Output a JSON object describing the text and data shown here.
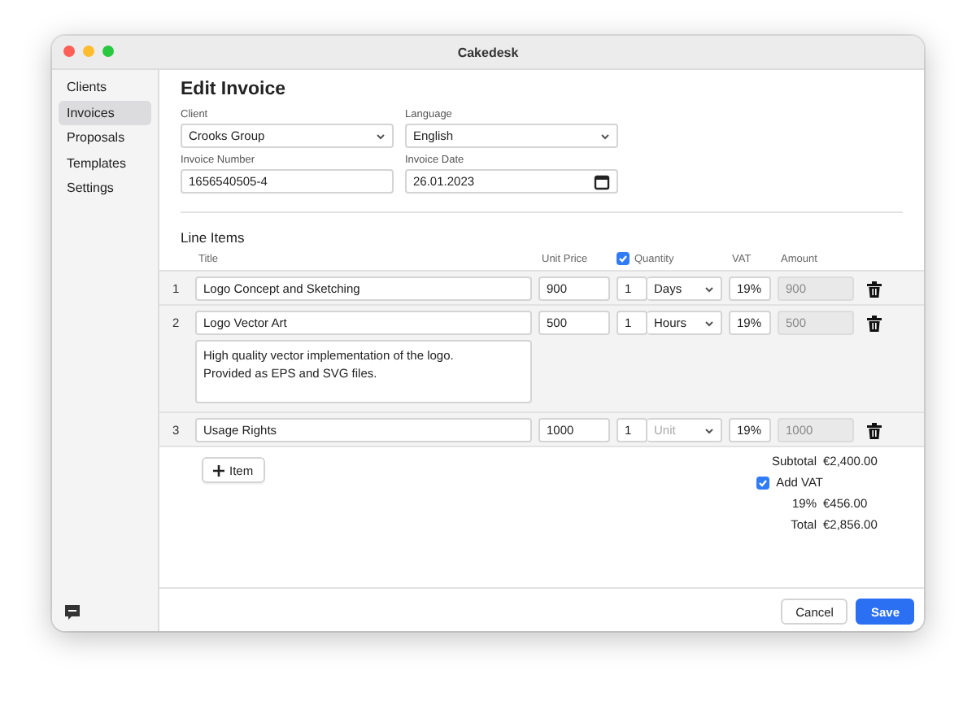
{
  "window": {
    "title": "Cakedesk"
  },
  "sidebar": {
    "items": [
      {
        "label": "Clients",
        "selected": false
      },
      {
        "label": "Invoices",
        "selected": true
      },
      {
        "label": "Proposals",
        "selected": false
      },
      {
        "label": "Templates",
        "selected": false
      },
      {
        "label": "Settings",
        "selected": false
      }
    ]
  },
  "form": {
    "heading": "Edit Invoice",
    "client": {
      "label": "Client",
      "value": "Crooks Group"
    },
    "language": {
      "label": "Language",
      "value": "English"
    },
    "invoice_number": {
      "label": "Invoice Number",
      "value": "1656540505-4"
    },
    "invoice_date": {
      "label": "Invoice Date",
      "value": "26.01.2023"
    }
  },
  "line_items": {
    "heading": "Line Items",
    "columns": {
      "title": "Title",
      "unit_price": "Unit Price",
      "quantity": "Quantity",
      "quantity_checked": true,
      "vat": "VAT",
      "amount": "Amount"
    },
    "rows": [
      {
        "number": "1",
        "title": "Logo Concept and Sketching",
        "unit_price": "900",
        "quantity": "1",
        "unit": "Days",
        "vat": "19%",
        "amount": "900"
      },
      {
        "number": "2",
        "title": "Logo Vector Art",
        "description": "High quality vector implementation of the logo.\nProvided as EPS and SVG files.",
        "unit_price": "500",
        "quantity": "1",
        "unit": "Hours",
        "vat": "19%",
        "amount": "500"
      },
      {
        "number": "3",
        "title": "Usage Rights",
        "unit_price": "1000",
        "quantity": "1",
        "unit_placeholder": "Unit",
        "vat": "19%",
        "amount": "1000"
      }
    ],
    "add_button": "Item"
  },
  "totals": {
    "subtotal_label": "Subtotal",
    "subtotal": "€2,400.00",
    "add_vat_label": "Add VAT",
    "add_vat_checked": true,
    "vat_label": "19%",
    "vat": "€456.00",
    "total_label": "Total",
    "total": "€2,856.00"
  },
  "buttons": {
    "cancel": "Cancel",
    "save": "Save"
  }
}
